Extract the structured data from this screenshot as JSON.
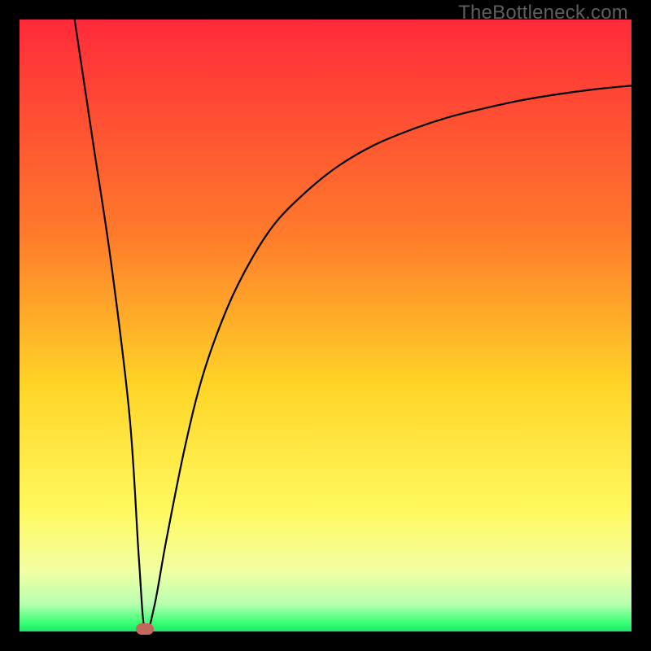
{
  "watermark": "TheBottleneck.com",
  "chart_data": {
    "type": "line",
    "title": "",
    "xlabel": "",
    "ylabel": "",
    "xlim": [
      0,
      100
    ],
    "ylim": [
      0,
      100
    ],
    "grid": false,
    "background": "heatmap-gradient-red-yellow-green",
    "marker": {
      "x": 20.5,
      "y": 0,
      "color": "#c1675c"
    },
    "series": [
      {
        "name": "curve",
        "x": [
          9,
          12,
          15,
          18,
          19.5,
          20.5,
          22,
          24,
          27,
          30,
          34,
          38,
          42,
          47,
          52,
          58,
          64,
          70,
          76,
          82,
          88,
          94,
          100
        ],
        "y": [
          100,
          80,
          60,
          35,
          12,
          0,
          4,
          15,
          30,
          42,
          53,
          61,
          67,
          72,
          76,
          79.5,
          82,
          84,
          85.5,
          86.8,
          87.8,
          88.6,
          89.2
        ]
      }
    ],
    "gradient_stops": [
      {
        "pos": 0.0,
        "color": "#ff2a3a"
      },
      {
        "pos": 0.35,
        "color": "#ff7a2b"
      },
      {
        "pos": 0.6,
        "color": "#ffd527"
      },
      {
        "pos": 0.8,
        "color": "#fff95e"
      },
      {
        "pos": 0.9,
        "color": "#f2ffa3"
      },
      {
        "pos": 0.955,
        "color": "#b9ffb0"
      },
      {
        "pos": 0.985,
        "color": "#3dff77"
      },
      {
        "pos": 1.0,
        "color": "#18e864"
      }
    ]
  }
}
